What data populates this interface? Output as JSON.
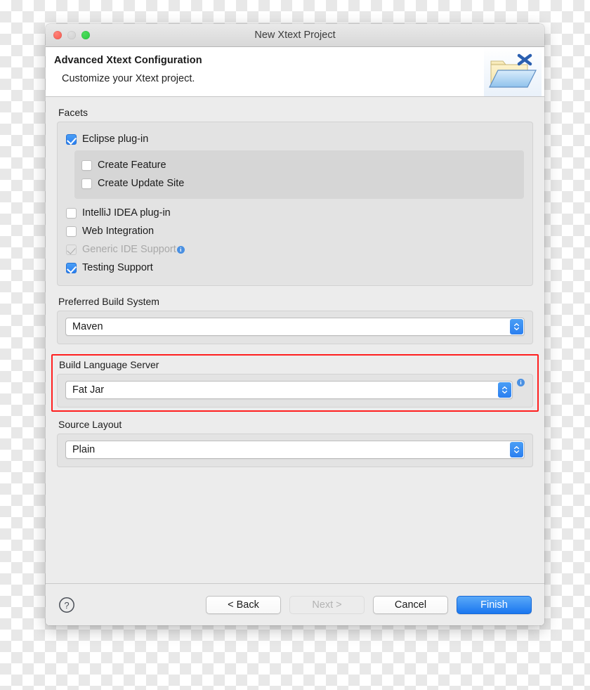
{
  "window": {
    "title": "New Xtext Project",
    "traffic_lights": [
      "close-button",
      "minimize-button",
      "zoom-button"
    ]
  },
  "header": {
    "title": "Advanced Xtext Configuration",
    "subtitle": "Customize your Xtext project.",
    "icon": "xtext-folder-icon"
  },
  "facets": {
    "label": "Facets",
    "items": [
      {
        "label": "Eclipse plug-in",
        "state": "checked",
        "enabled": true
      },
      {
        "label": "Create Feature",
        "state": "unchecked",
        "enabled": true
      },
      {
        "label": "Create Update Site",
        "state": "unchecked",
        "enabled": true
      },
      {
        "label": "IntelliJ IDEA plug-in",
        "state": "unchecked",
        "enabled": true
      },
      {
        "label": "Web Integration",
        "state": "unchecked",
        "enabled": true
      },
      {
        "label": "Generic IDE Support",
        "state": "checked",
        "enabled": false,
        "info": "i"
      },
      {
        "label": "Testing Support",
        "state": "checked",
        "enabled": true
      }
    ]
  },
  "build_system": {
    "label": "Preferred Build System",
    "value": "Maven"
  },
  "language_server": {
    "label": "Build Language Server",
    "value": "Fat Jar",
    "info": "i",
    "highlighted": true,
    "highlight_color": "#ff1f1f"
  },
  "source_layout": {
    "label": "Source Layout",
    "value": "Plain"
  },
  "footer": {
    "help": "?",
    "back": "< Back",
    "next": "Next >",
    "cancel": "Cancel",
    "finish": "Finish"
  }
}
